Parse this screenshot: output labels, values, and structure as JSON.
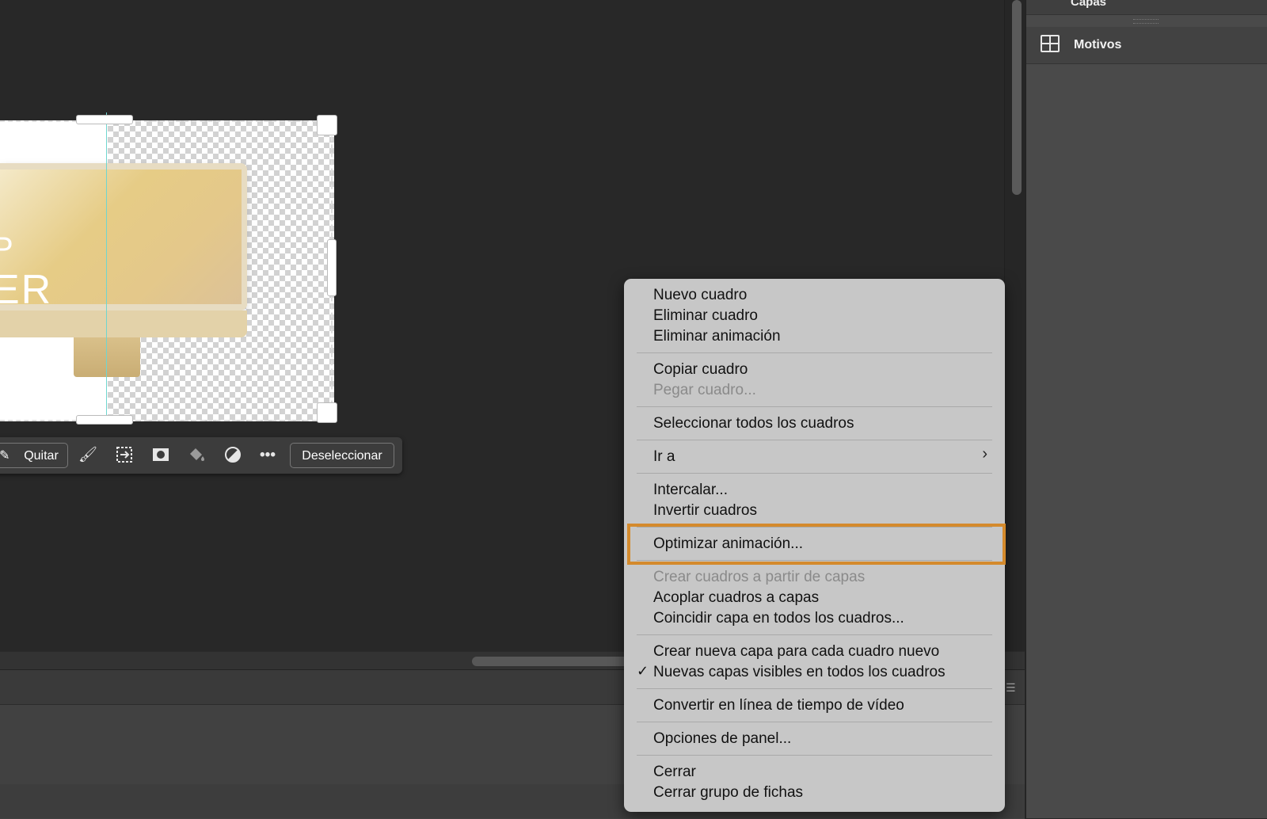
{
  "panel": {
    "tab_above_label": "Capas",
    "row_label": "Motivos",
    "row_icon": "patterns-grid-icon"
  },
  "document": {
    "display_text": "ER",
    "display_text_prefix": "P"
  },
  "taskbar": {
    "remove_label": "Quitar",
    "deselect_label": "Deseleccionar",
    "tools": [
      "brush-icon",
      "transform-selection-icon",
      "mask-icon",
      "fill-icon",
      "adjustment-icon",
      "more-icon"
    ]
  },
  "menu": {
    "groups": [
      [
        "Nuevo cuadro",
        "Eliminar cuadro",
        "Eliminar animación"
      ],
      [
        "Copiar cuadro",
        "Pegar cuadro..."
      ],
      [
        "Seleccionar todos los cuadros"
      ],
      [
        "Ir a"
      ],
      [
        "Intercalar...",
        "Invertir cuadros"
      ],
      [
        "Optimizar animación..."
      ],
      [
        "Crear cuadros a partir de capas",
        "Acoplar cuadros a capas",
        "Coincidir capa en todos los cuadros..."
      ],
      [
        "Crear nueva capa para cada cuadro nuevo",
        "Nuevas capas visibles en todos los cuadros"
      ],
      [
        "Convertir en línea de tiempo de vídeo"
      ],
      [
        "Opciones de panel..."
      ],
      [
        "Cerrar",
        "Cerrar grupo de fichas"
      ]
    ],
    "items": {
      "new_frame": "Nuevo cuadro",
      "delete_frame": "Eliminar cuadro",
      "delete_animation": "Eliminar animación",
      "copy_frame": "Copiar cuadro",
      "paste_frame": "Pegar cuadro...",
      "select_all_frames": "Seleccionar todos los cuadros",
      "go_to": "Ir a",
      "tween": "Intercalar...",
      "reverse_frames": "Invertir cuadros",
      "optimize_animation": "Optimizar animación...",
      "make_frames_from_layers": "Crear cuadros a partir de capas",
      "flatten_frames_into_layers": "Acoplar cuadros a capas",
      "match_layer_across_frames": "Coincidir capa en todos los cuadros...",
      "create_new_layer_each_frame": "Crear nueva capa para cada cuadro nuevo",
      "new_layers_visible_all_frames": "Nuevas capas visibles en todos los cuadros",
      "convert_to_video_timeline": "Convertir en línea de tiempo de vídeo",
      "panel_options": "Opciones de panel...",
      "close": "Cerrar",
      "close_tab_group": "Cerrar grupo de fichas"
    },
    "disabled": [
      "Pegar cuadro...",
      "Crear cuadros a partir de capas"
    ],
    "checked": [
      "Nuevas capas visibles en todos los cuadros"
    ],
    "highlighted": "Optimizar animación...",
    "highlight_color": "#d48a2c"
  }
}
